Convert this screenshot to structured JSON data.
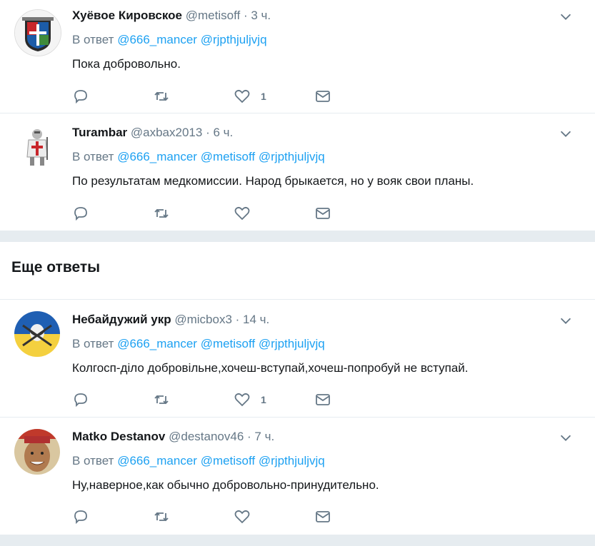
{
  "section_title": "Еще ответы",
  "tweets": [
    {
      "name": "Хуёвое Кировское",
      "handle": "@metisoff",
      "time": "3 ч.",
      "reply_prefix": "В ответ",
      "mentions": [
        "@666_mancer",
        "@rjpthjuljvjq"
      ],
      "text": "Пока добровольно.",
      "likes": "1"
    },
    {
      "name": "Turambar",
      "handle": "@axbax2013",
      "time": "6 ч.",
      "reply_prefix": "В ответ",
      "mentions": [
        "@666_mancer",
        "@metisoff",
        "@rjpthjuljvjq"
      ],
      "text": "По результатам медкомиссии. Народ брыкается, но у вояк свои планы.",
      "likes": ""
    },
    {
      "name": "Небайдужий укр",
      "handle": "@micbox3",
      "time": "14 ч.",
      "reply_prefix": "В ответ",
      "mentions": [
        "@666_mancer",
        "@metisoff",
        "@rjpthjuljvjq"
      ],
      "text": "Колгосп-діло добровільне,хочеш-вступай,хочеш-попробуй не вступай.",
      "likes": "1"
    },
    {
      "name": "Matko Destanov",
      "handle": "@destanov46",
      "time": "7 ч.",
      "reply_prefix": "В ответ",
      "mentions": [
        "@666_mancer",
        "@metisoff",
        "@rjpthjuljvjq"
      ],
      "text": "Ну,наверное,как обычно добровольно-принудительно.",
      "likes": ""
    }
  ],
  "icons": {
    "reply": "reply-icon",
    "retweet": "retweet-icon",
    "like": "heart-icon",
    "dm": "envelope-icon",
    "more": "chevron-down-icon"
  },
  "colors": {
    "link": "#1da1f2",
    "secondary": "#657786",
    "divider": "#e6ecf0",
    "text": "#14171a"
  }
}
